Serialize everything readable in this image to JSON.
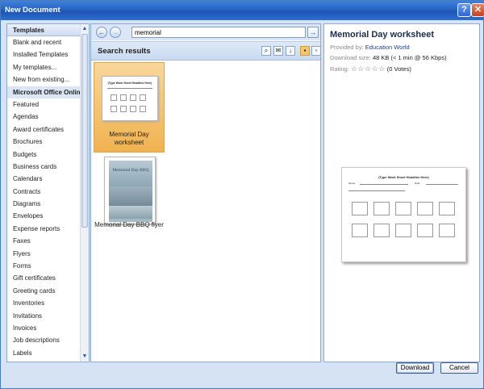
{
  "window": {
    "title": "New Document",
    "help_glyph": "?",
    "close_glyph": "✕"
  },
  "left_panel": {
    "header": "Templates",
    "items": [
      {
        "label": "Blank and recent"
      },
      {
        "label": "Installed Templates"
      },
      {
        "label": "My templates..."
      },
      {
        "label": "New from existing..."
      },
      {
        "label": "Microsoft Office Online",
        "section": true
      },
      {
        "label": "Featured"
      },
      {
        "label": "Agendas"
      },
      {
        "label": "Award certificates"
      },
      {
        "label": "Brochures"
      },
      {
        "label": "Budgets"
      },
      {
        "label": "Business cards"
      },
      {
        "label": "Calendars"
      },
      {
        "label": "Contracts"
      },
      {
        "label": "Diagrams"
      },
      {
        "label": "Envelopes"
      },
      {
        "label": "Expense reports"
      },
      {
        "label": "Faxes"
      },
      {
        "label": "Flyers"
      },
      {
        "label": "Forms"
      },
      {
        "label": "Gift certificates"
      },
      {
        "label": "Greeting cards"
      },
      {
        "label": "Inventories"
      },
      {
        "label": "Invitations"
      },
      {
        "label": "Invoices"
      },
      {
        "label": "Job descriptions"
      },
      {
        "label": "Labels"
      }
    ]
  },
  "search": {
    "query": "memorial",
    "back_glyph": "←",
    "forward_glyph": "→",
    "go_glyph": "→",
    "results_label": "Search results"
  },
  "results": [
    {
      "title": "Memorial Day worksheet",
      "selected": true
    },
    {
      "title": "Memorial Day BBQ flyer",
      "selected": false,
      "thumb_text": "Memorial Day BBQ"
    }
  ],
  "detail": {
    "title": "Memorial Day worksheet",
    "provided_by_label": "Provided by:",
    "provided_by": "Education World",
    "download_size_label": "Download size:",
    "download_size": "48 KB (< 1 min @ 56 Kbps)",
    "rating_label": "Rating:",
    "stars": "☆☆☆☆☆",
    "votes": "(0 Votes)",
    "preview_headline": "(Type Work Sheet Headline Here)"
  },
  "buttons": {
    "download": "Download",
    "cancel": "Cancel"
  }
}
